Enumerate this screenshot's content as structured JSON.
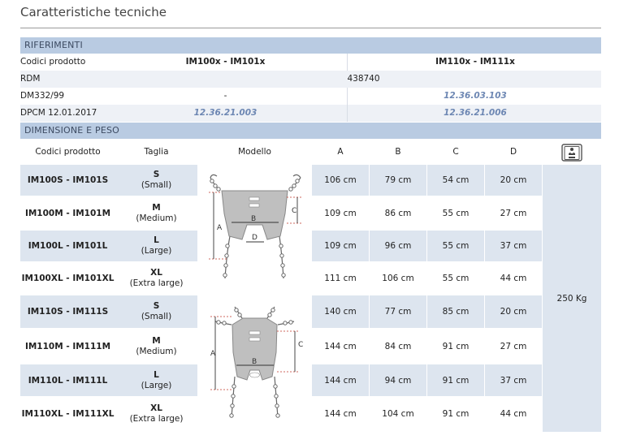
{
  "title": "Caratteristiche tecniche",
  "references": {
    "section_label": "RIFERIMENTI",
    "rows": [
      {
        "label": "Codici prodotto",
        "col1": "IM100x - IM101x",
        "col2": "IM110x - IM111x"
      },
      {
        "label": "RDM",
        "span": "438740"
      },
      {
        "label": "DM332/99",
        "col1": "-",
        "col2": "12.36.03.103"
      },
      {
        "label": "DPCM 12.01.2017",
        "col1": "12.36.21.003",
        "col2": "12.36.21.006"
      }
    ]
  },
  "dimensions": {
    "section_label": "DIMENSIONE E PESO",
    "headers": {
      "code": "Codici prodotto",
      "size": "Taglia",
      "model": "Modello",
      "a": "A",
      "b": "B",
      "c": "C",
      "d": "D",
      "weight_icon": "weight-capacity-icon"
    },
    "rows": [
      {
        "code": "IM100S - IM101S",
        "size": "S",
        "size_name": "(Small)",
        "a": "106 cm",
        "b": "79 cm",
        "c": "54 cm",
        "d": "20 cm"
      },
      {
        "code": "IM100M - IM101M",
        "size": "M",
        "size_name": "(Medium)",
        "a": "109 cm",
        "b": "86 cm",
        "c": "55 cm",
        "d": "27 cm"
      },
      {
        "code": "IM100L - IM101L",
        "size": "L",
        "size_name": "(Large)",
        "a": "109 cm",
        "b": "96 cm",
        "c": "55 cm",
        "d": "37 cm"
      },
      {
        "code": "IM100XL - IM101XL",
        "size": "XL",
        "size_name": "(Extra large)",
        "a": "111 cm",
        "b": "106 cm",
        "c": "55 cm",
        "d": "44 cm"
      },
      {
        "code": "IM110S - IM111S",
        "size": "S",
        "size_name": "(Small)",
        "a": "140 cm",
        "b": "77 cm",
        "c": "85 cm",
        "d": "20 cm"
      },
      {
        "code": "IM110M - IM111M",
        "size": "M",
        "size_name": "(Medium)",
        "a": "144 cm",
        "b": "84 cm",
        "c": "91 cm",
        "d": "27 cm"
      },
      {
        "code": "IM110L - IM111L",
        "size": "L",
        "size_name": "(Large)",
        "a": "144 cm",
        "b": "94 cm",
        "c": "91 cm",
        "d": "37 cm"
      },
      {
        "code": "IM110XL - IM111XL",
        "size": "XL",
        "size_name": "(Extra large)",
        "a": "144 cm",
        "b": "104 cm",
        "c": "91 cm",
        "d": "44 cm"
      }
    ],
    "weight": "250 Kg",
    "diagram_labels": {
      "a": "A",
      "b": "B",
      "c": "C",
      "d": "D"
    }
  },
  "colors": {
    "section_bg": "#b9cbe2",
    "row_shade": "#dde5ef",
    "code_blue": "#6d87b3",
    "dimension_line": "#c0392b"
  }
}
